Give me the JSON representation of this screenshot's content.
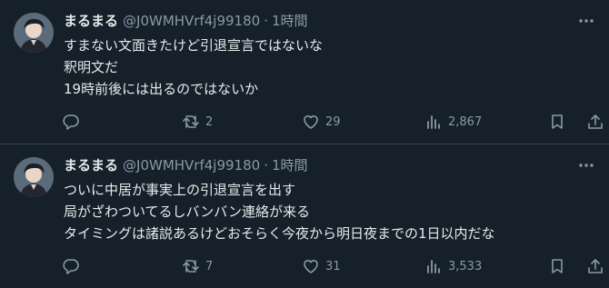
{
  "tweets": [
    {
      "name": "まるまる",
      "handle": "@J0WMHVrf4j99180",
      "separator": "·",
      "time": "1時間",
      "lines": [
        "すまない文面きたけど引退宣言ではないな",
        "釈明文だ",
        "19時前後には出るのではないか"
      ],
      "replies": "",
      "retweets": "2",
      "likes": "29",
      "views": "2,867"
    },
    {
      "name": "まるまる",
      "handle": "@J0WMHVrf4j99180",
      "separator": "·",
      "time": "1時間",
      "lines": [
        "ついに中居が事実上の引退宣言を出す",
        "局がざわついてるしバンバン連絡が来る",
        "タイミングは諸説あるけどおそらく今夜から明日夜までの1日以内だな"
      ],
      "replies": "",
      "retweets": "7",
      "likes": "31",
      "views": "3,533"
    }
  ],
  "colors": {
    "background": "#15202b",
    "text": "#e7e9ea",
    "muted": "#8b98a5",
    "divider": "#38444d"
  },
  "icons": [
    "avatar",
    "more-icon",
    "reply-icon",
    "retweet-icon",
    "like-icon",
    "views-icon",
    "bookmark-icon",
    "share-icon"
  ]
}
